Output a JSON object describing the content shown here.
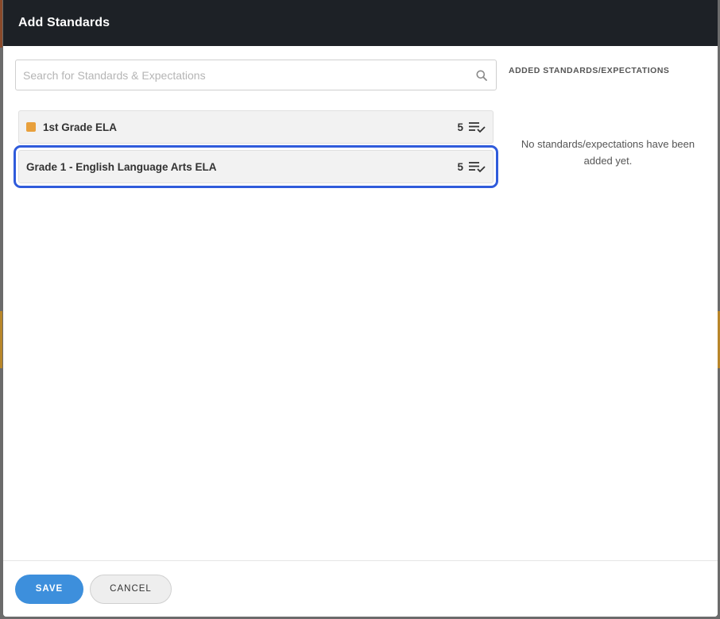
{
  "modal": {
    "title": "Add Standards"
  },
  "search": {
    "placeholder": "Search for Standards & Expectations",
    "value": ""
  },
  "list": {
    "items": [
      {
        "label": "1st Grade ELA",
        "count": "5",
        "swatch_color": "#e8a03c",
        "focused": false
      },
      {
        "label": "Grade 1 - English Language Arts ELA",
        "count": "5",
        "swatch_color": "",
        "focused": true
      }
    ]
  },
  "right_panel": {
    "heading": "ADDED STANDARDS/EXPECTATIONS",
    "empty_message": "No standards/expectations have been added yet."
  },
  "footer": {
    "save_label": "SAVE",
    "cancel_label": "CANCEL"
  },
  "colors": {
    "header_bg": "#1d2126",
    "save_button": "#3d8fdc",
    "focus_ring": "#2f5bdb"
  },
  "icons": {
    "search": "search-icon",
    "list_check": "list-check-icon"
  }
}
